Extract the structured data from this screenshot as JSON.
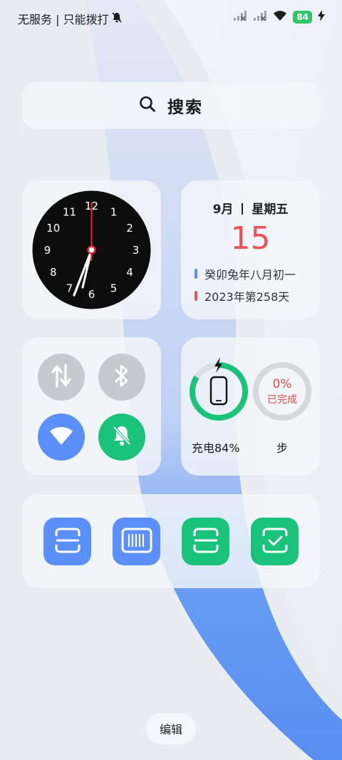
{
  "status_bar": {
    "carrier_text": "无服务 | 只能拨打",
    "battery_level": "84",
    "icons": [
      "mute-bell-icon",
      "no-signal-icon",
      "no-signal-icon",
      "wifi-icon",
      "battery-icon",
      "charging-bolt-icon"
    ]
  },
  "search": {
    "label": "搜索"
  },
  "clock": {
    "numbers": [
      "12",
      "1",
      "2",
      "3",
      "4",
      "5",
      "6",
      "7",
      "8",
      "9",
      "10",
      "11"
    ]
  },
  "calendar": {
    "month": "9月",
    "weekday": "星期五",
    "day": "15",
    "lunar": "癸卯兔年八月初一",
    "year_day": "2023年第258天",
    "colors": {
      "day": "#f0505a",
      "lunar_bar": "#5b8ff9",
      "year_bar": "#f0505a"
    }
  },
  "toggles": [
    {
      "name": "mobile-data",
      "icon": "up-down-arrows-icon",
      "color": "#c6c9ce"
    },
    {
      "name": "bluetooth",
      "icon": "bluetooth-icon",
      "color": "#c6c9ce"
    },
    {
      "name": "wifi",
      "icon": "wifi-icon",
      "color": "#5b8ff9"
    },
    {
      "name": "mute",
      "icon": "mute-bell-icon",
      "color": "#19c37a"
    }
  ],
  "stats": {
    "charging_label": "充电84%",
    "charge_fraction": 0.84,
    "steps_percent": "0%",
    "steps_status": "已完成",
    "steps_label": "步"
  },
  "shortcuts": [
    {
      "name": "scan-alipay",
      "icon": "scan-icon",
      "color": "#5b8ff9"
    },
    {
      "name": "barcode-pay",
      "icon": "barcode-icon",
      "color": "#5b8ff9"
    },
    {
      "name": "scan-wechat",
      "icon": "scan-icon",
      "color": "#19c37a"
    },
    {
      "name": "scan-checkmark",
      "icon": "scan-check-icon",
      "color": "#19c37a"
    }
  ],
  "edit_label": "编辑"
}
